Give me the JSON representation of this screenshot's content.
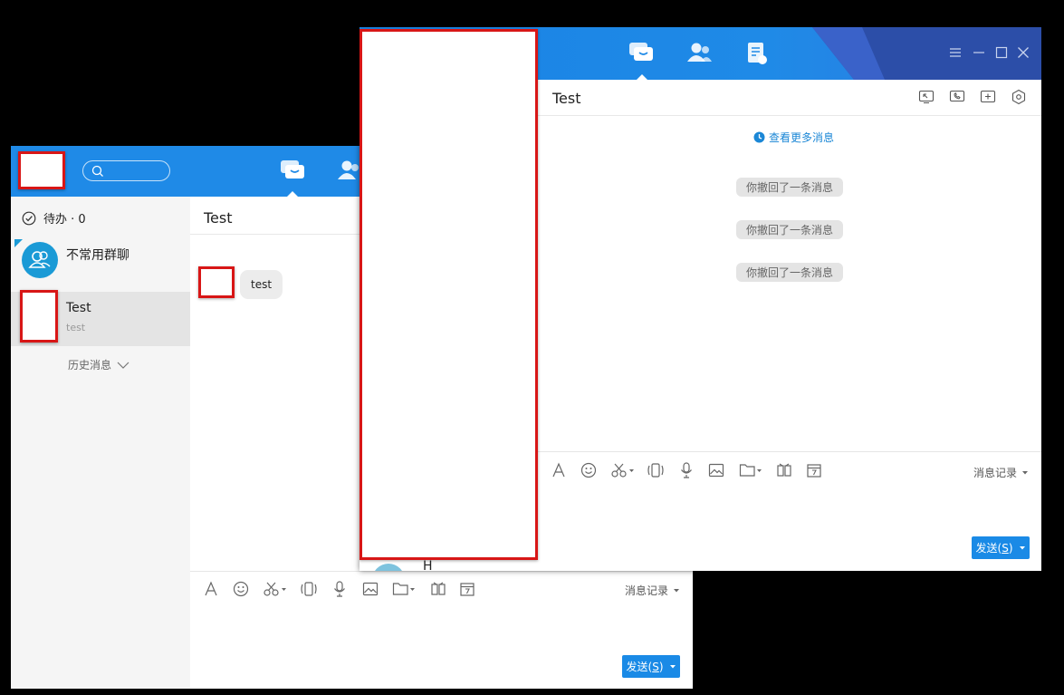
{
  "back_window": {
    "todo": "待办 · 0",
    "conversations": [
      {
        "name": "不常用群聊",
        "preview": ""
      },
      {
        "name": "Test",
        "preview": "test"
      }
    ],
    "history": "历史消息",
    "chat_title": "Test",
    "messages": [
      {
        "text": "test"
      }
    ],
    "toolbar": {
      "message_record": "消息记录"
    },
    "send": {
      "label": "发送(",
      "key": "S",
      "suffix": ")"
    },
    "peek_text": "H"
  },
  "front_window": {
    "chat_title": "Test",
    "view_more": "查看更多消息",
    "recalled": [
      "你撤回了一条消息",
      "你撤回了一条消息",
      "你撤回了一条消息"
    ],
    "toolbar": {
      "message_record": "消息记录"
    },
    "send": {
      "label": "发送(",
      "key": "S",
      "suffix": ")"
    }
  },
  "colors": {
    "brand_blue": "#1f8ae7",
    "dark_band": "#2c4ea8",
    "redaction": "#d81616",
    "send_blue": "#1a8ae6"
  },
  "icons": [
    "search-icon",
    "chat-tab-icon",
    "contacts-tab-icon",
    "docs-tab-icon",
    "todo-check-icon",
    "group-avatar-icon",
    "chevron-down-icon",
    "font-icon",
    "emoji-icon",
    "scissors-icon",
    "shake-icon",
    "mic-icon",
    "image-icon",
    "folder-icon",
    "apps-icon",
    "calendar-icon",
    "menu-icon",
    "minimize-icon",
    "maximize-icon",
    "close-icon",
    "screen-share-icon",
    "phone-icon",
    "add-member-icon",
    "settings-icon",
    "clock-icon"
  ]
}
